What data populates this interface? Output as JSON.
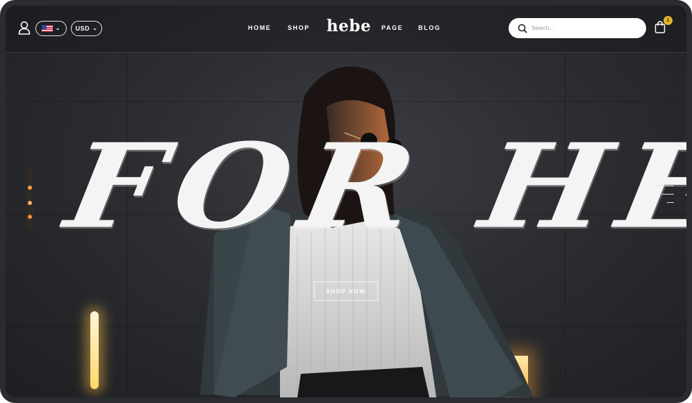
{
  "header": {
    "language": {
      "flag": "us-flag-icon"
    },
    "currency": {
      "label": "USD"
    },
    "nav_left": [
      "HOME",
      "SHOP"
    ],
    "logo": "hebe",
    "nav_right": [
      "PAGE",
      "BLOG"
    ],
    "search": {
      "placeholder": "Search..."
    },
    "cart": {
      "count": "1"
    }
  },
  "hero": {
    "title": "FOR HER",
    "button_label": "SHOP NOW"
  },
  "colors": {
    "background": "#2b2d31",
    "badge": "#e4b42a",
    "text": "#ffffff"
  }
}
